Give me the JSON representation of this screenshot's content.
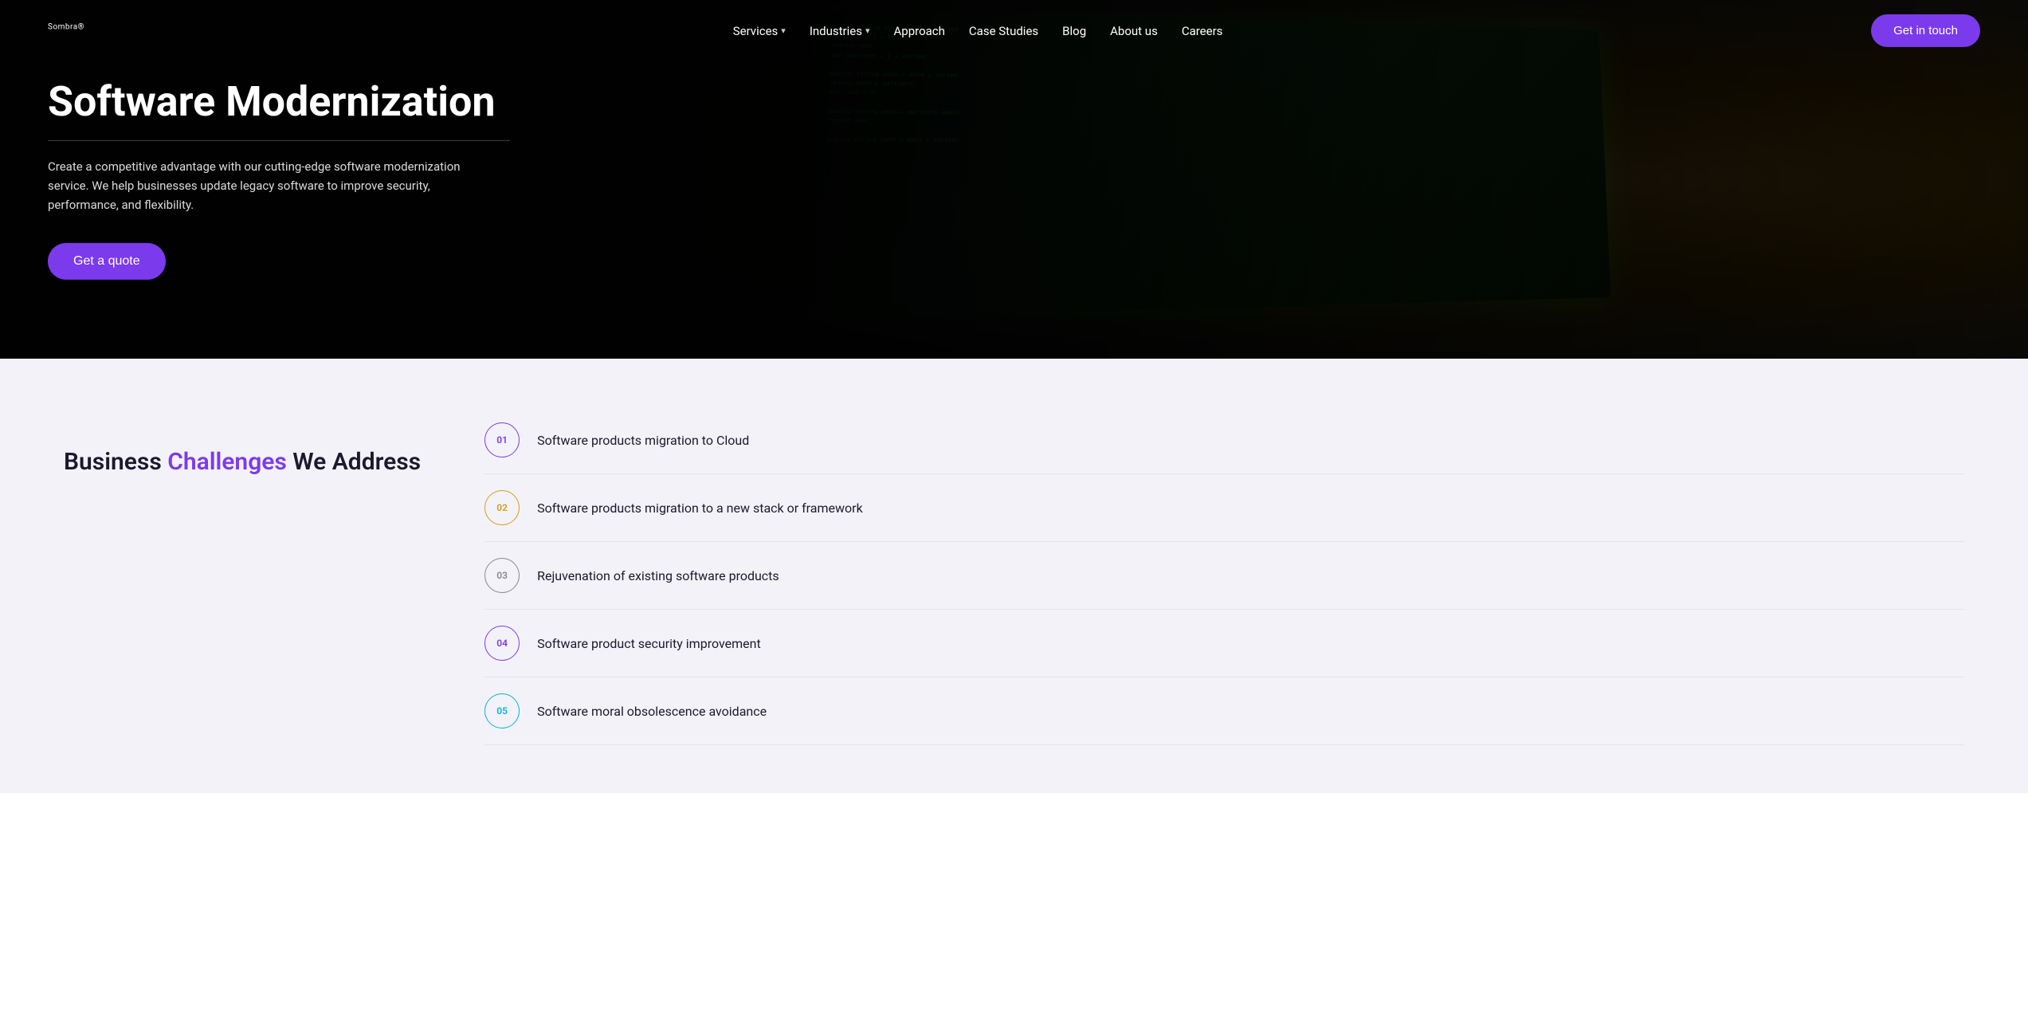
{
  "navbar": {
    "logo": "Sombra",
    "logo_tm": "®",
    "links": [
      {
        "id": "services",
        "label": "Services",
        "has_dropdown": true
      },
      {
        "id": "industries",
        "label": "Industries",
        "has_dropdown": true
      },
      {
        "id": "approach",
        "label": "Approach",
        "has_dropdown": false
      },
      {
        "id": "case-studies",
        "label": "Case Studies",
        "has_dropdown": false
      },
      {
        "id": "blog",
        "label": "Blog",
        "has_dropdown": false
      },
      {
        "id": "about-us",
        "label": "About us",
        "has_dropdown": false
      },
      {
        "id": "careers",
        "label": "Careers",
        "has_dropdown": false
      }
    ],
    "cta_label": "Get in touch"
  },
  "hero": {
    "title": "Software Modernization",
    "description": "Create a competitive advantage with our cutting-edge software modernization service. We help businesses update legacy software to improve security, performance, and flexibility.",
    "cta_label": "Get a quote"
  },
  "lower": {
    "title_plain": "Business",
    "title_highlight": "Challenges",
    "title_suffix": "We Address",
    "services": [
      {
        "number": "01",
        "label": "Software products migration to Cloud",
        "badge_class": "badge-01"
      },
      {
        "number": "02",
        "label": "Software products migration to a new stack or framework",
        "badge_class": "badge-02"
      },
      {
        "number": "03",
        "label": "Rejuvenation of existing software products",
        "badge_class": "badge-03"
      },
      {
        "number": "04",
        "label": "Software product security improvement",
        "badge_class": "badge-04"
      },
      {
        "number": "05",
        "label": "Software moral obsolescence avoidance",
        "badge_class": "badge-05"
      }
    ]
  },
  "code_lines": [
    "public string path = data + sorted;",
    "var data = i + height;",
    "return real;",
    "var partners = i + sorted;",
    "",
    "public string path = data + sorted;",
    "return data = partners;",
    "var real = 0;",
    "",
    "public string path = partners.email",
    "return real;",
    "",
    "public string path = data + sorted;"
  ]
}
